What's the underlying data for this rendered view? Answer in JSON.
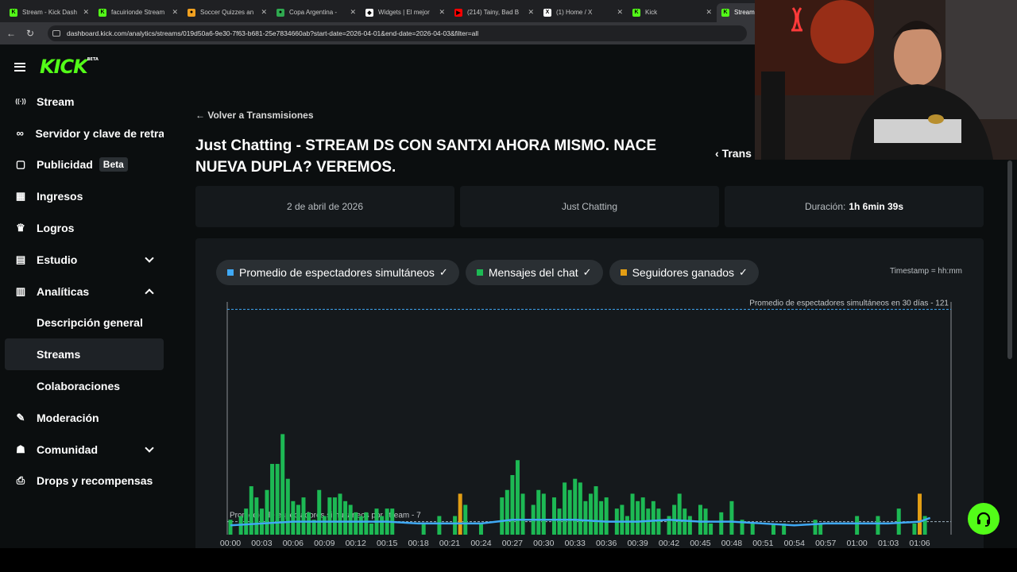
{
  "browser": {
    "tabs": [
      {
        "label": "Stream - Kick Dash",
        "color": "#53fc18",
        "glyph": "K"
      },
      {
        "label": "facuirionde Stream",
        "color": "#53fc18",
        "glyph": "K"
      },
      {
        "label": "Soccer Quizzes an",
        "color": "#f0a020",
        "glyph": "●"
      },
      {
        "label": "Copa Argentina -",
        "color": "#2fa84f",
        "glyph": "●"
      },
      {
        "label": "Widgets | El mejor",
        "color": "#ffffff",
        "glyph": "◆"
      },
      {
        "label": "(214) Tainy, Bad B",
        "color": "#ff0000",
        "glyph": "▶"
      },
      {
        "label": "(1) Home / X",
        "color": "#ffffff",
        "glyph": "X"
      },
      {
        "label": "Kick",
        "color": "#53fc18",
        "glyph": "K"
      },
      {
        "label": "Stream",
        "color": "#53fc18",
        "glyph": "K"
      }
    ],
    "url": "dashboard.kick.com/analytics/streams/019d50a6-9e30-7f63-b681-25e7834660ab?start-date=2026-04-01&end-date=2026-04-03&filter=all"
  },
  "sidebar": {
    "logo": "KICK",
    "logo_badge": "BETA",
    "items": [
      {
        "label": "Stream",
        "icon": "broadcast-icon",
        "glyph": "((·))"
      },
      {
        "label": "Servidor y clave de retrans",
        "icon": "link-icon",
        "glyph": "∞"
      },
      {
        "label": "Publicidad",
        "icon": "ad-icon",
        "glyph": "▢",
        "badge": "Beta"
      },
      {
        "label": "Ingresos",
        "icon": "revenue-icon",
        "glyph": "▦"
      },
      {
        "label": "Logros",
        "icon": "trophy-icon",
        "glyph": "♛"
      },
      {
        "label": "Estudio",
        "icon": "studio-icon",
        "glyph": "▤",
        "chevron": "down"
      },
      {
        "label": "Analíticas",
        "icon": "analytics-icon",
        "glyph": "▥",
        "chevron": "up"
      },
      {
        "label": "Descripción general",
        "sub": true
      },
      {
        "label": "Streams",
        "sub": true,
        "active": true
      },
      {
        "label": "Colaboraciones",
        "sub": true
      },
      {
        "label": "Moderación",
        "icon": "wrench-icon",
        "glyph": "✎"
      },
      {
        "label": "Comunidad",
        "icon": "community-icon",
        "glyph": "☗",
        "chevron": "down"
      },
      {
        "label": "Drops y recompensas",
        "icon": "drops-icon",
        "glyph": "⎙"
      }
    ]
  },
  "main": {
    "back_label": "Volver a Transmisiones",
    "title": "Just Chatting - STREAM DS CON SANTXI AHORA MISMO. NACE NUEVA DUPLA? VEREMOS.",
    "prev_label": "Trans",
    "cards": {
      "date": "2 de abril de 2026",
      "category": "Just Chatting",
      "duration_label": "Duración:",
      "duration_value": "1h 6min 39s"
    },
    "pills": [
      {
        "label": "Promedio de espectadores simultáneos",
        "color": "#3fa9f5"
      },
      {
        "label": "Mensajes del chat",
        "color": "#1db954"
      },
      {
        "label": "Seguidores ganados",
        "color": "#e39e14"
      }
    ],
    "timestamp_note": "Timestamp = hh:mm"
  },
  "chart_data": {
    "type": "bar",
    "x_tick_labels": [
      "00:00",
      "00:03",
      "00:06",
      "00:09",
      "00:12",
      "00:15",
      "00:18",
      "00:21",
      "00:24",
      "00:27",
      "00:30",
      "00:33",
      "00:36",
      "00:39",
      "00:42",
      "00:45",
      "00:48",
      "00:51",
      "00:54",
      "00:57",
      "01:00",
      "01:03",
      "01:06"
    ],
    "reference_lines": [
      {
        "label": "Promedio de espectadores simultáneos en 30 días - 121",
        "value": 121
      },
      {
        "label": "Promedio de espectadores simultáneos por stream - 7",
        "value": 7
      }
    ],
    "ylim": [
      0,
      125
    ],
    "series": [
      {
        "name": "Mensajes del chat",
        "color": "#1db954",
        "x_minutes": [
          0,
          1,
          1.5,
          2,
          2.5,
          3,
          3.5,
          4,
          4.5,
          5,
          5.5,
          6,
          6.5,
          7,
          7.5,
          8,
          8.5,
          9,
          9.5,
          10,
          10.5,
          11,
          11.5,
          12,
          12.5,
          13,
          13.5,
          14,
          14.5,
          15,
          15.5,
          18.5,
          20,
          21.5,
          22.5,
          24,
          26,
          26.5,
          27,
          27.5,
          28,
          29,
          29.5,
          30,
          31,
          31.5,
          32,
          32.5,
          33,
          33.5,
          34,
          34.5,
          35,
          35.5,
          36,
          37,
          37.5,
          38,
          38.5,
          39,
          39.5,
          40,
          40.5,
          41,
          42,
          42.5,
          43,
          43.5,
          44,
          45,
          45.5,
          46,
          47,
          48,
          49,
          50,
          52,
          53,
          56,
          56.5,
          60,
          62,
          64,
          65.5,
          66,
          66.5
        ],
        "values": [
          8,
          10,
          14,
          26,
          20,
          14,
          24,
          38,
          38,
          54,
          30,
          18,
          16,
          20,
          12,
          8,
          24,
          10,
          20,
          20,
          22,
          18,
          16,
          12,
          10,
          12,
          6,
          14,
          10,
          14,
          14,
          6,
          10,
          10,
          16,
          6,
          20,
          24,
          32,
          40,
          22,
          16,
          24,
          22,
          20,
          14,
          28,
          24,
          30,
          28,
          18,
          22,
          26,
          18,
          20,
          14,
          16,
          10,
          22,
          18,
          20,
          14,
          18,
          14,
          10,
          16,
          22,
          14,
          10,
          16,
          14,
          6,
          12,
          18,
          8,
          6,
          6,
          6,
          8,
          6,
          10,
          10,
          14,
          6,
          10,
          10
        ]
      },
      {
        "name": "Seguidores ganados",
        "color": "#e39e14",
        "x_minutes": [
          22,
          66
        ],
        "values": [
          22,
          22
        ]
      },
      {
        "name": "Promedio de espectadores simultáneos",
        "color": "#3fa9f5",
        "x_minutes": [
          0,
          3,
          6,
          9,
          12,
          15,
          18,
          21,
          24,
          27,
          30,
          33,
          36,
          39,
          42,
          45,
          48,
          51,
          54,
          57,
          60,
          63,
          66,
          67
        ],
        "values": [
          5,
          6,
          7,
          7,
          7,
          7,
          6,
          6,
          6,
          8,
          8,
          8,
          7,
          7,
          8,
          7,
          7,
          6,
          5,
          6,
          6,
          6,
          7,
          9
        ]
      }
    ]
  }
}
